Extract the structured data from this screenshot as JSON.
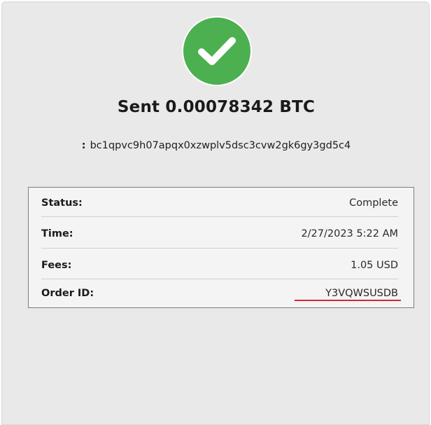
{
  "status_icon": "checkmark-circle-icon",
  "colors": {
    "success": "#4cb050",
    "underline": "#d42a2a"
  },
  "header": {
    "title": "Sent 0.00078342 BTC"
  },
  "recipient": {
    "label": ":",
    "address": "bc1qpvc9h07apqx0xzwplv5dsc3cvw2gk6gy3gd5c4"
  },
  "details": [
    {
      "label": "Status:",
      "value": "Complete"
    },
    {
      "label": "Time:",
      "value": "2/27/2023 5:22 AM"
    },
    {
      "label": "Fees:",
      "value": "1.05 USD"
    },
    {
      "label": "Order ID:",
      "value": "Y3VQWSUSDB"
    }
  ]
}
